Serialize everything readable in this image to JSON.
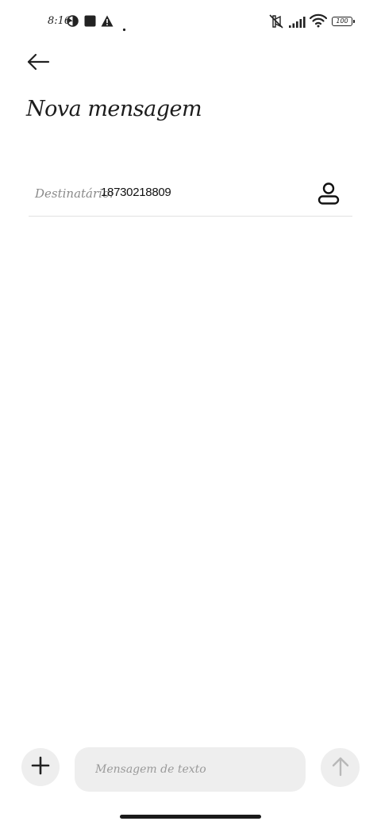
{
  "status_bar": {
    "time": "8:16",
    "battery": "100",
    "icons": [
      "theme-icon",
      "stop-icon",
      "warning-icon",
      "dot-icon",
      "mute-icon",
      "signal-icon",
      "wifi-icon",
      "battery-icon"
    ]
  },
  "header": {
    "back_icon": "arrow-left-icon",
    "title": "Nova mensagem"
  },
  "recipient": {
    "label": "Destinatário:",
    "value": "18730218809",
    "contact_icon": "person-icon"
  },
  "composer": {
    "add_icon": "plus-icon",
    "placeholder": "Mensagem de texto",
    "value": "",
    "send_icon": "arrow-up-icon"
  }
}
